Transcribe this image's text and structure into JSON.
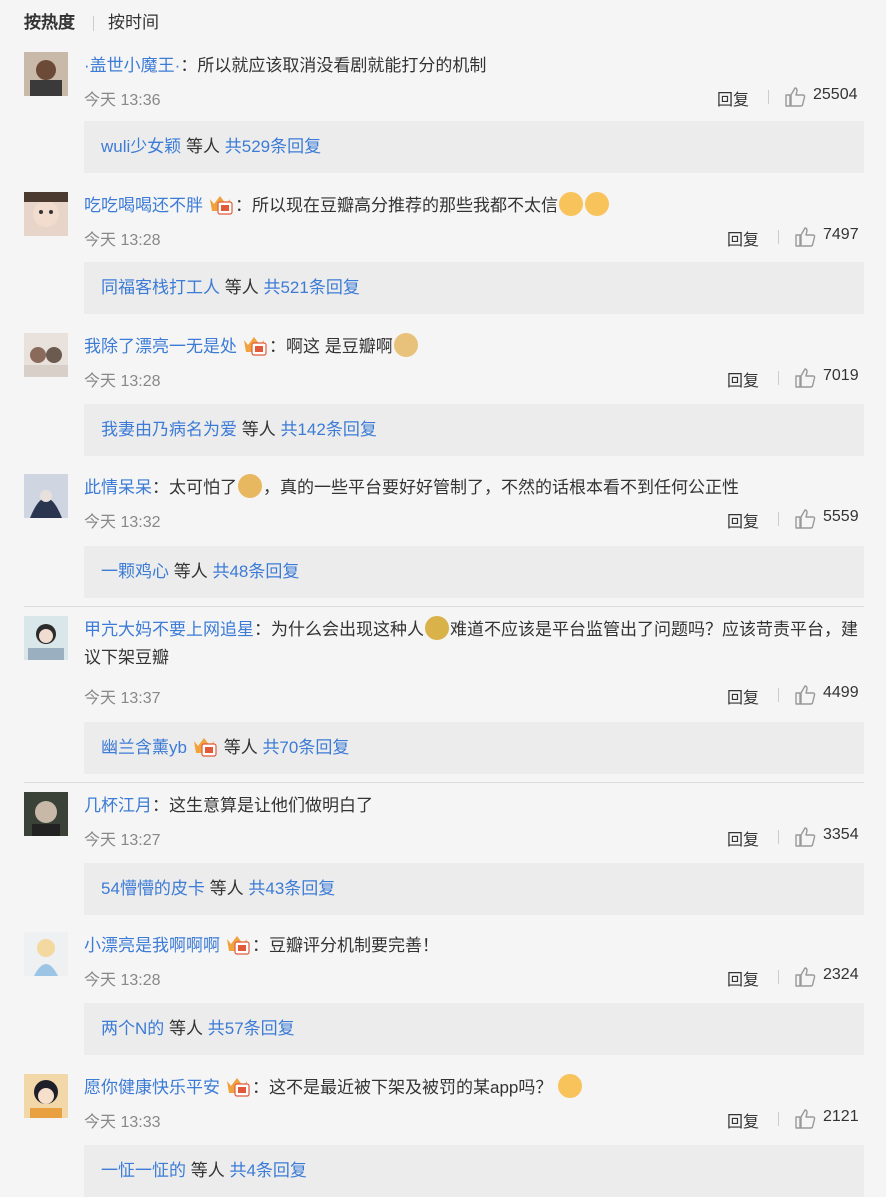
{
  "tabs": {
    "hot": "按热度",
    "time": "按时间"
  },
  "ui": {
    "reply_label": "回复",
    "etc_label": "等人"
  },
  "colors": {
    "link": "#3c7bd6",
    "badge": "#f0a23c",
    "sub_bg": "#ececec"
  },
  "comments": [
    {
      "user": "·盖世小魔王·",
      "text": "所以就应该取消没看剧就能打分的机制",
      "time": "今天 13:36",
      "likes": "25504",
      "sub_user": "wuli少女颖",
      "sub_count": "共529条回复"
    },
    {
      "user": "吃吃喝喝还不胖",
      "text": "所以现在豆瓣高分推荐的那些我都不太信",
      "time": "今天 13:28",
      "likes": "7497",
      "sub_user": "同福客栈打工人",
      "sub_count": "共521条回复"
    },
    {
      "user": "我除了漂亮一无是处",
      "text": "啊这 是豆瓣啊",
      "time": "今天 13:28",
      "likes": "7019",
      "sub_user": "我妻由乃病名为爱",
      "sub_count": "共142条回复"
    },
    {
      "user": "此情呆呆",
      "text_a": "太可怕了",
      "text_b": "，真的一些平台要好好管制了，不然的话根本看不到任何公正性",
      "time": "今天 13:32",
      "likes": "5559",
      "sub_user": "一颗鸡心",
      "sub_count": "共48条回复"
    },
    {
      "user": "甲亢大妈不要上网追星",
      "text_a": "为什么会出现这种人",
      "text_b": "难道不应该是平台监管出了问题吗？应该苛责平台，建议下架豆瓣",
      "time": "今天 13:37",
      "likes": "4499",
      "sub_user": "幽兰含薰yb",
      "sub_count": "共70条回复"
    },
    {
      "user": "几杯江月",
      "text": "这生意算是让他们做明白了",
      "time": "今天 13:27",
      "likes": "3354",
      "sub_user": "54懵懵的皮卡",
      "sub_count": "共43条回复"
    },
    {
      "user": "小漂亮是我啊啊啊",
      "text": "豆瓣评分机制要完善！",
      "time": "今天 13:28",
      "likes": "2324",
      "sub_user": "两个N的",
      "sub_count": "共57条回复"
    },
    {
      "user": "愿你健康快乐平安",
      "text": "这不是最近被下架及被罚的某app吗？",
      "time": "今天 13:33",
      "likes": "2121",
      "sub_user": "一怔一怔的",
      "sub_count": "共4条回复"
    }
  ]
}
